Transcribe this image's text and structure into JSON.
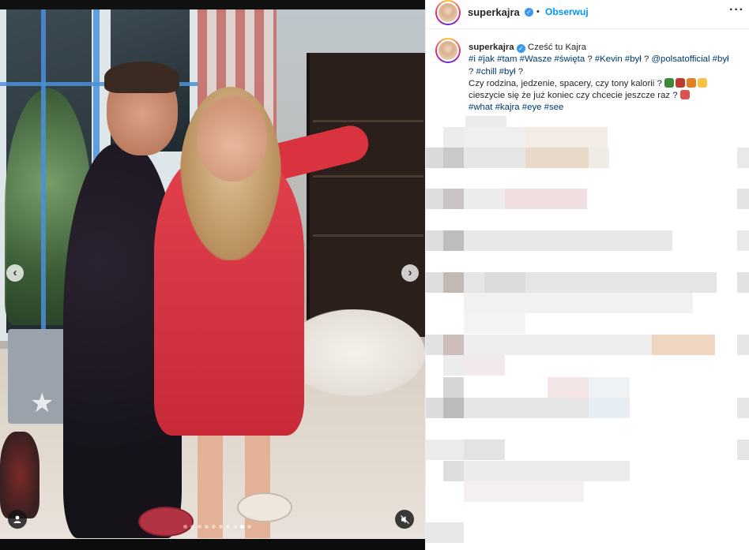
{
  "post": {
    "username": "superkajra",
    "follow_label": "Obserwuj",
    "bullet": "•",
    "more_label": "···",
    "verified_mark": "✓"
  },
  "caption": {
    "username": "superkajra",
    "greeting": "Cześć tu Kajra",
    "tags_line1": [
      "#i",
      "#jak",
      "#tam",
      "#Wasze",
      "#święta",
      "?",
      "#Kevin",
      "#był",
      "?",
      "@polsatofficial",
      "#był"
    ],
    "tags_line2": [
      "?",
      "#chill",
      "#był",
      "?"
    ],
    "text_line3": "Czy rodzina, jedzenie, spacery, czy tony kalorii ?",
    "text_line4": "cieszycie się że już koniec czy chcecie jeszcze raz ?",
    "tags_line5": [
      "#what",
      "#kajra",
      "#eye",
      "#see"
    ],
    "emoji_line3": [
      "tree-emoji",
      "devil-emoji",
      "gift-emoji",
      "laugh-emoji"
    ],
    "emoji_line4": [
      "santa-emoji"
    ],
    "emoji_colors": {
      "tree-emoji": "#3b8a3a",
      "devil-emoji": "#c0392b",
      "gift-emoji": "#e67e22",
      "laugh-emoji": "#f5c542",
      "santa-emoji": "#d9534f"
    }
  },
  "media": {
    "carousel_count": 10,
    "carousel_active_index": 8,
    "prev_icon": "chevron-left-icon",
    "next_icon": "chevron-right-icon",
    "prev_glyph": "‹",
    "next_glyph": "›",
    "user_tag_icon": "user-icon",
    "mute_icon": "mute-icon"
  },
  "colors": {
    "link": "#00376b",
    "accent": "#0095f6",
    "verified": "#3897f0"
  }
}
